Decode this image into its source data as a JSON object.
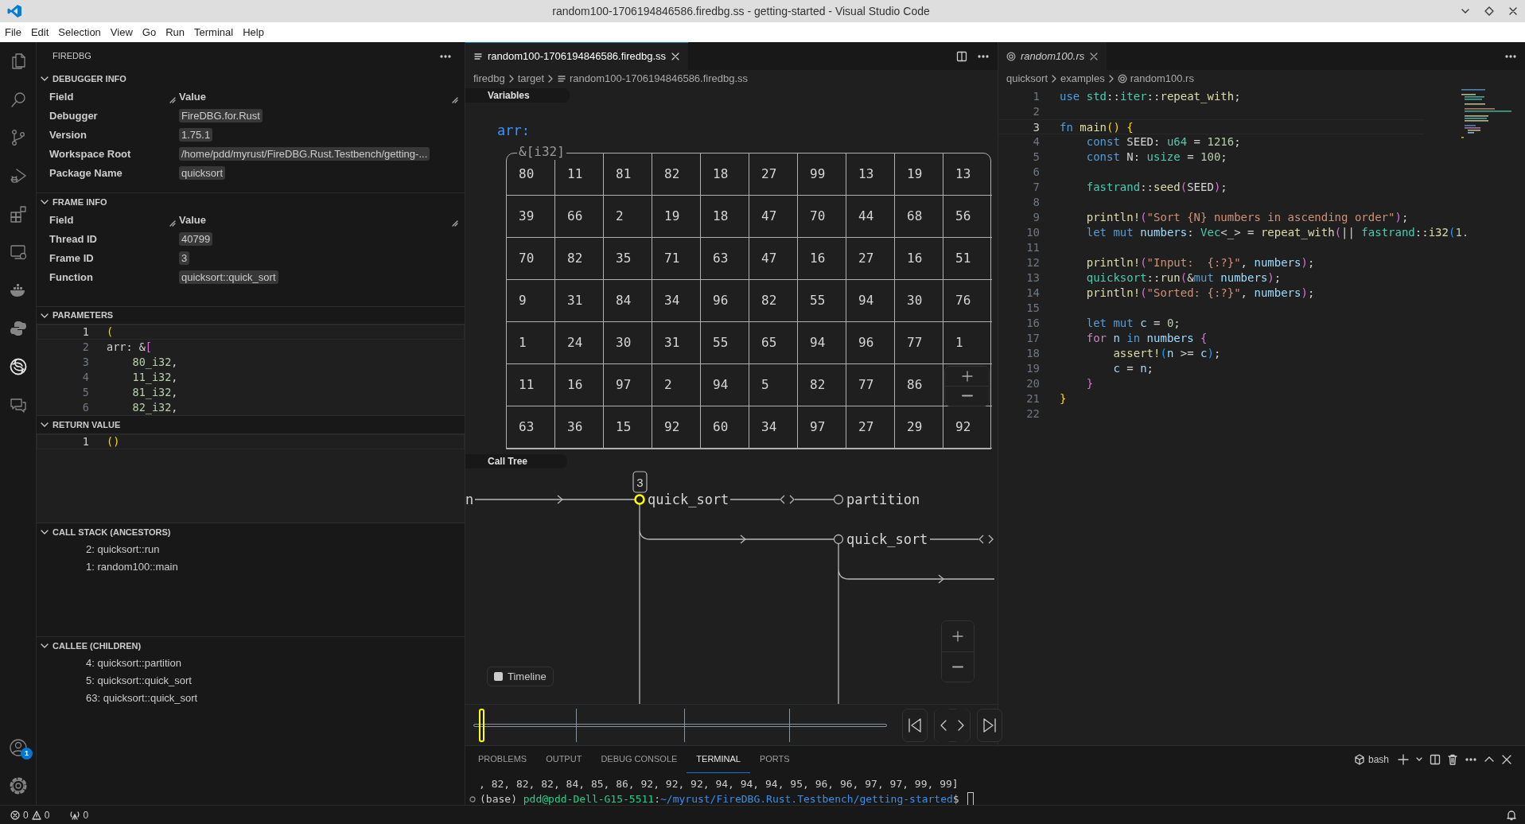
{
  "window": {
    "title": "random100-1706194846586.firedbg.ss - getting-started - Visual Studio Code"
  },
  "menu": [
    "File",
    "Edit",
    "Selection",
    "View",
    "Go",
    "Run",
    "Terminal",
    "Help"
  ],
  "activity_bar": {
    "items": [
      {
        "kind": "files",
        "selected": false
      },
      {
        "kind": "search",
        "selected": false
      },
      {
        "kind": "branch",
        "selected": false
      },
      {
        "kind": "debug",
        "selected": false
      },
      {
        "kind": "blocks",
        "selected": false
      },
      {
        "kind": "monitor",
        "selected": false
      },
      {
        "kind": "whale",
        "selected": false
      },
      {
        "kind": "snake",
        "selected": false
      },
      {
        "kind": "swirl",
        "selected": true
      },
      {
        "kind": "chat",
        "selected": false
      }
    ],
    "bottom": [
      {
        "kind": "account",
        "badge": "1"
      },
      {
        "kind": "settings"
      }
    ]
  },
  "sidebar": {
    "title": "FIREDBG",
    "sections": [
      {
        "kind": "table",
        "title": "DEBUGGER INFO",
        "expanded": true,
        "columns": [
          "Field",
          "Value"
        ],
        "rows": [
          [
            "Debugger",
            "FireDBG.for.Rust"
          ],
          [
            "Version",
            "1.75.1"
          ],
          [
            "Workspace Root",
            "/home/pdd/myrust/FireDBG.Rust.Testbench/getting-..."
          ],
          [
            "Package Name",
            "quicksort"
          ]
        ]
      },
      {
        "kind": "table",
        "title": "FRAME INFO",
        "expanded": true,
        "columns": [
          "Field",
          "Value"
        ],
        "rows": [
          [
            "Thread ID",
            "40799"
          ],
          [
            "Frame ID",
            "3"
          ],
          [
            "Function",
            "quicksort::quick_sort"
          ]
        ]
      },
      {
        "kind": "code",
        "title": "PARAMETERS",
        "expanded": true,
        "lines": [
          {
            "number": "1",
            "current": true,
            "tokens": [
              {
                "text": "(",
                "kind": "b1"
              }
            ]
          },
          {
            "number": "2",
            "current": false,
            "tokens": [
              {
                "text": "arr: &",
                "kind": "p"
              },
              {
                "text": "[",
                "kind": "b2"
              }
            ]
          },
          {
            "number": "3",
            "current": false,
            "tokens": [
              {
                "text": "    80_i32",
                "kind": "n"
              },
              {
                "text": ",",
                "kind": "p"
              }
            ]
          },
          {
            "number": "4",
            "current": false,
            "tokens": [
              {
                "text": "    11_i32",
                "kind": "n"
              },
              {
                "text": ",",
                "kind": "p"
              }
            ]
          },
          {
            "number": "5",
            "current": false,
            "tokens": [
              {
                "text": "    81_i32",
                "kind": "n"
              },
              {
                "text": ",",
                "kind": "p"
              }
            ]
          },
          {
            "number": "6",
            "current": false,
            "tokens": [
              {
                "text": "    82_i32",
                "kind": "n"
              },
              {
                "text": ",",
                "kind": "p"
              }
            ]
          }
        ]
      },
      {
        "kind": "code",
        "title": "RETURN VALUE",
        "expanded": true,
        "lines": [
          {
            "number": "1",
            "current": true,
            "tokens": [
              {
                "text": "()",
                "kind": "b1"
              }
            ]
          }
        ]
      },
      {
        "kind": "list",
        "title": "CALL STACK (ANCESTORS)",
        "expanded": true,
        "items": [
          "2: quicksort::run",
          "1: random100::main"
        ]
      },
      {
        "kind": "list",
        "title": "CALLEE (CHILDREN)",
        "expanded": true,
        "items": [
          "4: quicksort::partition",
          "5: quicksort::quick_sort",
          "63: quicksort::quick_sort"
        ]
      }
    ]
  },
  "editor_left": {
    "tab": {
      "label": "random100-1706194846586.firedbg.ss",
      "selected": true
    },
    "breadcrumbs": [
      "firedbg",
      "target",
      "random100-1706194846586.firedbg.ss"
    ],
    "variables": {
      "title": "Variables",
      "name": "arr:",
      "type": "&[i32]",
      "rows": [
        [
          "80",
          "11",
          "81",
          "82",
          "18",
          "27",
          "99",
          "13",
          "19",
          "13"
        ],
        [
          "39",
          "66",
          "2",
          "19",
          "18",
          "47",
          "70",
          "44",
          "68",
          "56"
        ],
        [
          "70",
          "82",
          "35",
          "71",
          "63",
          "47",
          "16",
          "27",
          "16",
          "51"
        ],
        [
          "9",
          "31",
          "84",
          "34",
          "96",
          "82",
          "55",
          "94",
          "30",
          "76"
        ],
        [
          "1",
          "24",
          "30",
          "31",
          "55",
          "65",
          "94",
          "96",
          "77",
          "1"
        ],
        [
          "11",
          "16",
          "97",
          "2",
          "94",
          "5",
          "82",
          "77",
          "86"
        ],
        [
          "63",
          "36",
          "15",
          "92",
          "60",
          "34",
          "97",
          "27",
          "29",
          "92"
        ]
      ]
    },
    "call_tree": {
      "title": "Call Tree",
      "edge_label": "n",
      "badge": "3",
      "nodes": [
        {
          "label": "quick_sort",
          "current": true
        },
        {
          "label": "partition",
          "current": false
        },
        {
          "label": "quick_sort",
          "current": false
        }
      ]
    },
    "timeline": {
      "label": "Timeline",
      "checked": false,
      "level": 0.025
    }
  },
  "editor_right": {
    "tab": {
      "label": "random100.rs",
      "preview": true
    },
    "breadcrumbs": [
      "quicksort",
      "examples",
      "random100.rs"
    ],
    "lines": [
      {
        "number": "1",
        "current": false,
        "tokens": [
          {
            "text": "use",
            "kind": "k"
          },
          {
            "text": " std",
            "kind": "t"
          },
          {
            "text": "::",
            "kind": "p"
          },
          {
            "text": "iter",
            "kind": "t"
          },
          {
            "text": "::",
            "kind": "p"
          },
          {
            "text": "repeat_with",
            "kind": "f"
          },
          {
            "text": ";",
            "kind": "p"
          }
        ]
      },
      {
        "number": "2",
        "current": false
      },
      {
        "number": "3",
        "current": true,
        "tokens": [
          {
            "text": "fn",
            "kind": "k"
          },
          {
            "text": " main",
            "kind": "f"
          },
          {
            "text": "()",
            "kind": "b1"
          },
          {
            "text": " {",
            "kind": "b1"
          }
        ]
      },
      {
        "number": "4",
        "current": false,
        "tokens": [
          {
            "text": "    const",
            "kind": "k"
          },
          {
            "text": " SEED: ",
            "kind": "p"
          },
          {
            "text": "u64",
            "kind": "t"
          },
          {
            "text": " = ",
            "kind": "p"
          },
          {
            "text": "1216",
            "kind": "n"
          },
          {
            "text": ";",
            "kind": "p"
          }
        ]
      },
      {
        "number": "5",
        "current": false,
        "tokens": [
          {
            "text": "    const",
            "kind": "k"
          },
          {
            "text": " N: ",
            "kind": "p"
          },
          {
            "text": "usize",
            "kind": "t"
          },
          {
            "text": " = ",
            "kind": "p"
          },
          {
            "text": "100",
            "kind": "n"
          },
          {
            "text": ";",
            "kind": "p"
          }
        ]
      },
      {
        "number": "6",
        "current": false
      },
      {
        "number": "7",
        "current": false,
        "tokens": [
          {
            "text": "    fastrand",
            "kind": "t"
          },
          {
            "text": "::",
            "kind": "p"
          },
          {
            "text": "seed",
            "kind": "f"
          },
          {
            "text": "(",
            "kind": "b2"
          },
          {
            "text": "SEED",
            "kind": "p"
          },
          {
            "text": ")",
            "kind": "b2"
          },
          {
            "text": ";",
            "kind": "p"
          }
        ]
      },
      {
        "number": "8",
        "current": false
      },
      {
        "number": "9",
        "current": false,
        "tokens": [
          {
            "text": "    println!",
            "kind": "f"
          },
          {
            "text": "(",
            "kind": "b2"
          },
          {
            "text": "\"Sort {N} numbers in ascending order\"",
            "kind": "s"
          },
          {
            "text": ")",
            "kind": "b2"
          },
          {
            "text": ";",
            "kind": "p"
          }
        ]
      },
      {
        "number": "10",
        "current": false,
        "tokens": [
          {
            "text": "    let",
            "kind": "k"
          },
          {
            "text": " mut",
            "kind": "k"
          },
          {
            "text": " numbers",
            "kind": "v"
          },
          {
            "text": ": ",
            "kind": "p"
          },
          {
            "text": "Vec",
            "kind": "t"
          },
          {
            "text": "<_>",
            "kind": "p"
          },
          {
            "text": " = ",
            "kind": "p"
          },
          {
            "text": "repeat_with",
            "kind": "f"
          },
          {
            "text": "(",
            "kind": "b2"
          },
          {
            "text": "||",
            "kind": "p"
          },
          {
            "text": " fastrand",
            "kind": "t"
          },
          {
            "text": "::",
            "kind": "p"
          },
          {
            "text": "i32",
            "kind": "f"
          },
          {
            "text": "(",
            "kind": "b3"
          },
          {
            "text": "1.",
            "kind": "n"
          }
        ]
      },
      {
        "number": "11",
        "current": false
      },
      {
        "number": "12",
        "current": false,
        "tokens": [
          {
            "text": "    println!",
            "kind": "f"
          },
          {
            "text": "(",
            "kind": "b2"
          },
          {
            "text": "\"Input:  {:?}\"",
            "kind": "s"
          },
          {
            "text": ", ",
            "kind": "p"
          },
          {
            "text": "numbers",
            "kind": "v"
          },
          {
            "text": ")",
            "kind": "b2"
          },
          {
            "text": ";",
            "kind": "p"
          }
        ]
      },
      {
        "number": "13",
        "current": false,
        "tokens": [
          {
            "text": "    quicksort",
            "kind": "t"
          },
          {
            "text": "::",
            "kind": "p"
          },
          {
            "text": "run",
            "kind": "f"
          },
          {
            "text": "(",
            "kind": "b2"
          },
          {
            "text": "&",
            "kind": "p"
          },
          {
            "text": "mut",
            "kind": "k"
          },
          {
            "text": " numbers",
            "kind": "v"
          },
          {
            "text": ")",
            "kind": "b2"
          },
          {
            "text": ";",
            "kind": "p"
          }
        ]
      },
      {
        "number": "14",
        "current": false,
        "tokens": [
          {
            "text": "    println!",
            "kind": "f"
          },
          {
            "text": "(",
            "kind": "b2"
          },
          {
            "text": "\"Sorted: {:?}\"",
            "kind": "s"
          },
          {
            "text": ", ",
            "kind": "p"
          },
          {
            "text": "numbers",
            "kind": "v"
          },
          {
            "text": ")",
            "kind": "b2"
          },
          {
            "text": ";",
            "kind": "p"
          }
        ]
      },
      {
        "number": "15",
        "current": false
      },
      {
        "number": "16",
        "current": false,
        "tokens": [
          {
            "text": "    let",
            "kind": "k"
          },
          {
            "text": " mut",
            "kind": "k"
          },
          {
            "text": " c",
            "kind": "v"
          },
          {
            "text": " = ",
            "kind": "p"
          },
          {
            "text": "0",
            "kind": "n"
          },
          {
            "text": ";",
            "kind": "p"
          }
        ]
      },
      {
        "number": "17",
        "current": false,
        "tokens": [
          {
            "text": "    for",
            "kind": "c"
          },
          {
            "text": " n",
            "kind": "v"
          },
          {
            "text": " in",
            "kind": "k"
          },
          {
            "text": " numbers",
            "kind": "v"
          },
          {
            "text": " {",
            "kind": "b2"
          }
        ]
      },
      {
        "number": "18",
        "current": false,
        "tokens": [
          {
            "text": "        assert!",
            "kind": "f"
          },
          {
            "text": "(",
            "kind": "b3"
          },
          {
            "text": "n",
            "kind": "v"
          },
          {
            "text": " >= ",
            "kind": "p"
          },
          {
            "text": "c",
            "kind": "v"
          },
          {
            "text": ")",
            "kind": "b3"
          },
          {
            "text": ";",
            "kind": "p"
          }
        ]
      },
      {
        "number": "19",
        "current": false,
        "tokens": [
          {
            "text": "        c",
            "kind": "v"
          },
          {
            "text": " = ",
            "kind": "p"
          },
          {
            "text": "n",
            "kind": "v"
          },
          {
            "text": ";",
            "kind": "p"
          }
        ]
      },
      {
        "number": "20",
        "current": false,
        "tokens": [
          {
            "text": "    }",
            "kind": "b2"
          }
        ]
      },
      {
        "number": "21",
        "current": false,
        "tokens": [
          {
            "text": "}",
            "kind": "b1"
          }
        ]
      },
      {
        "number": "22",
        "current": false
      }
    ]
  },
  "panel": {
    "tabs": [
      {
        "label": "PROBLEMS",
        "selected": false
      },
      {
        "label": "OUTPUT",
        "selected": false
      },
      {
        "label": "DEBUG CONSOLE",
        "selected": false
      },
      {
        "label": "TERMINAL",
        "selected": true
      },
      {
        "label": "PORTS",
        "selected": false
      }
    ],
    "terminal_profile": "bash",
    "output": ", 82, 82, 82, 84, 85, 86, 92, 92, 92, 94, 94, 94, 95, 96, 96, 97, 97, 99, 99]",
    "prompt": {
      "env": "(base)",
      "user_host": "pdd@pdd-Dell-G15-5511",
      "separator": ":",
      "path": "~/myrust/FireDBG.Rust.Testbench/getting-started",
      "symbol": "$"
    }
  },
  "status_bar": {
    "errors": "0",
    "warnings": "0",
    "ports": "0"
  }
}
